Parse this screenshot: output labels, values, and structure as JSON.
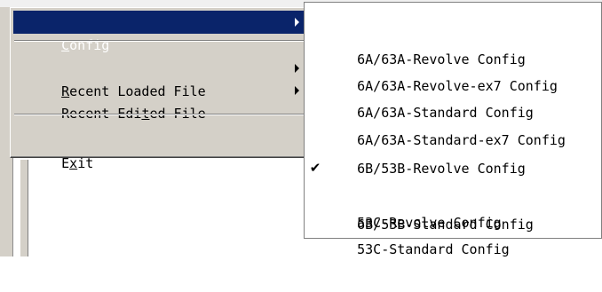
{
  "menu": {
    "items": [
      {
        "pre": "",
        "mnemonic": "C",
        "post": "onfig",
        "has_submenu": true,
        "highlighted": true
      },
      {
        "pre": "",
        "mnemonic": "R",
        "post": "ecent Loaded File",
        "has_submenu": true,
        "highlighted": false
      },
      {
        "pre": "Recent Edi",
        "mnemonic": "t",
        "post": "ed File",
        "has_submenu": true,
        "highlighted": false
      },
      {
        "pre": "E",
        "mnemonic": "x",
        "post": "it",
        "has_submenu": false,
        "highlighted": false
      }
    ]
  },
  "submenu": {
    "items": [
      {
        "label": "6A/63A-Revolve Config",
        "checked": false
      },
      {
        "label": "6A/63A-Revolve-ex7 Config",
        "checked": false
      },
      {
        "label": "6A/63A-Standard Config",
        "checked": false
      },
      {
        "label": "6A/63A-Standard-ex7 Config",
        "checked": false
      },
      {
        "label": "6B/53B-Revolve Config",
        "checked": false
      },
      {
        "label": "6B/53B-Standard Config",
        "checked": true
      },
      {
        "label": "53C-Revolve Config",
        "checked": false
      },
      {
        "label": "53C-Standard Config",
        "checked": false
      }
    ],
    "check_glyph": "✔"
  },
  "colors": {
    "menu_bg": "#d4d0c8",
    "highlight_bg": "#0a246a",
    "highlight_fg": "#ffffff",
    "submenu_bg": "#ffffff"
  }
}
